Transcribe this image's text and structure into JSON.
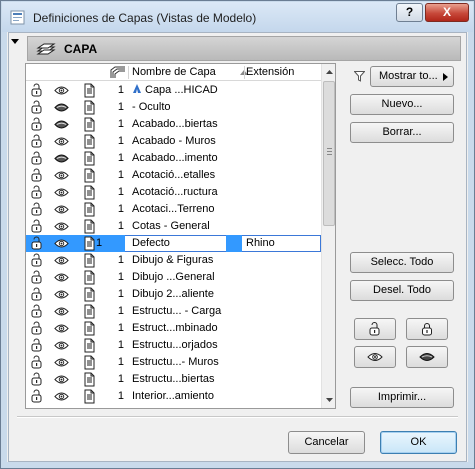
{
  "window": {
    "title": "Definiciones de Capas (Vistas de Modelo)",
    "help_label": "?",
    "close_label": "X"
  },
  "section": {
    "title": "CAPA"
  },
  "columns": {
    "name": "Nombre de Capa",
    "extension": "Extensión"
  },
  "rows": [
    {
      "num": "1",
      "name": "Capa ...HICAD",
      "ext": "",
      "vis": "open",
      "name_icon": true,
      "selected": false
    },
    {
      "num": "1",
      "name": "- Oculto",
      "ext": "",
      "vis": "closed",
      "selected": false
    },
    {
      "num": "1",
      "name": "Acabado...biertas",
      "ext": "",
      "vis": "closed",
      "selected": false
    },
    {
      "num": "1",
      "name": "Acabado - Muros",
      "ext": "",
      "vis": "open",
      "selected": false
    },
    {
      "num": "1",
      "name": "Acabado...imento",
      "ext": "",
      "vis": "closed",
      "selected": false
    },
    {
      "num": "1",
      "name": "Acotació...etalles",
      "ext": "",
      "vis": "open",
      "selected": false
    },
    {
      "num": "1",
      "name": "Acotació...ructura",
      "ext": "",
      "vis": "open",
      "selected": false
    },
    {
      "num": "1",
      "name": "Acotaci...Terreno",
      "ext": "",
      "vis": "open",
      "selected": false
    },
    {
      "num": "1",
      "name": "Cotas - General",
      "ext": "",
      "vis": "open",
      "selected": false
    },
    {
      "num": "1",
      "name": "Defecto",
      "ext": "Rhino",
      "vis": "open",
      "selected": true
    },
    {
      "num": "1",
      "name": "Dibujo & Figuras",
      "ext": "",
      "vis": "open",
      "selected": false
    },
    {
      "num": "1",
      "name": "Dibujo ...General",
      "ext": "",
      "vis": "open",
      "selected": false
    },
    {
      "num": "1",
      "name": "Dibujo 2...aliente",
      "ext": "",
      "vis": "open",
      "selected": false
    },
    {
      "num": "1",
      "name": "Estructu... - Carga",
      "ext": "",
      "vis": "open",
      "selected": false
    },
    {
      "num": "1",
      "name": "Estruct...mbinado",
      "ext": "",
      "vis": "open",
      "selected": false
    },
    {
      "num": "1",
      "name": "Estructu...orjados",
      "ext": "",
      "vis": "open",
      "selected": false
    },
    {
      "num": "1",
      "name": "Estructu...- Muros",
      "ext": "",
      "vis": "open",
      "selected": false
    },
    {
      "num": "1",
      "name": "Estructu...biertas",
      "ext": "",
      "vis": "open",
      "selected": false
    },
    {
      "num": "1",
      "name": "Interior...amiento",
      "ext": "",
      "vis": "open",
      "selected": false
    }
  ],
  "buttons": {
    "show": "Mostrar to...",
    "new": "Nuevo...",
    "delete": "Borrar...",
    "select_all": "Selecc. Todo",
    "deselect_all": "Desel. Todo",
    "print": "Imprimir...",
    "cancel": "Cancelar",
    "ok": "OK"
  },
  "icons": {
    "lock_column": "lock-open-icon",
    "visibility_column": "eye-icon",
    "wireframe_column": "wireframe-page-icon",
    "filter": "filter-icon"
  },
  "colors": {
    "selection": "#3399ff",
    "default_button_border": "#3c7fb1",
    "close_button": "#c7493a"
  }
}
